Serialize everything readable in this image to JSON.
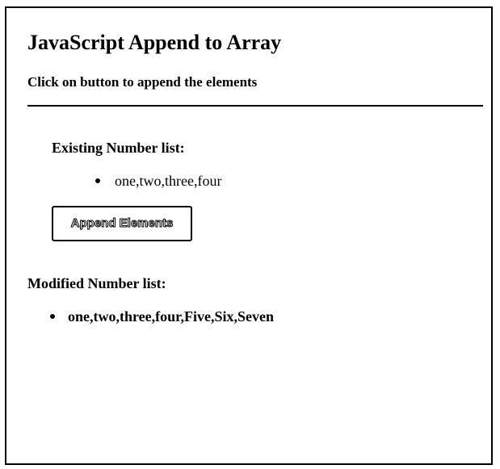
{
  "header": {
    "title": "JavaScript Append to Array",
    "subtitle": "Click on button to append the elements"
  },
  "existing": {
    "heading": "Existing Number list:",
    "items": [
      "one,two,three,four"
    ]
  },
  "button": {
    "label": "Append Elements"
  },
  "modified": {
    "heading": "Modified Number list:",
    "items": [
      "one,two,three,four,Five,Six,Seven"
    ]
  },
  "colors": {
    "text": "#000000",
    "background": "#ffffff",
    "border": "#000000"
  }
}
